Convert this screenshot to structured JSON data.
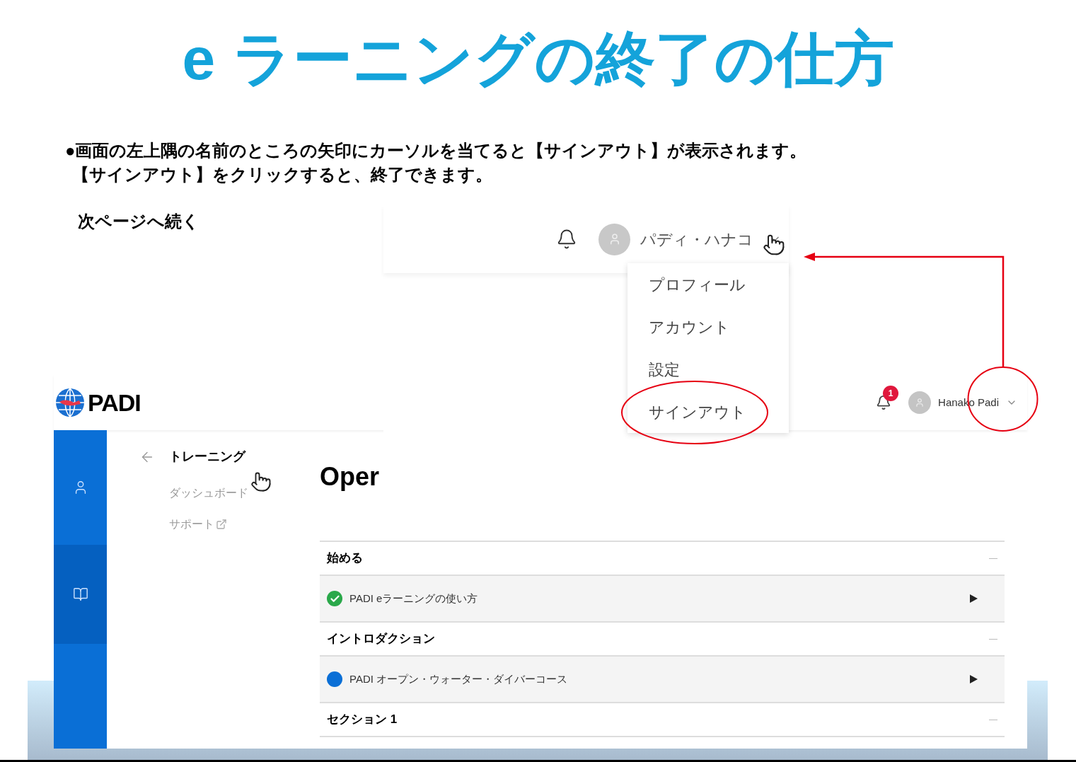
{
  "title": "e ラーニングの終了の仕方",
  "instructions": [
    "●画面の左上隅の名前のところの矢印にカーソルを当てると【サインアウト】が表示されます。",
    "【サインアウト】をクリックすると、終了できます。"
  ],
  "note": "次ページへ続く",
  "popup": {
    "user_name": "パディ・ハナコ",
    "menu": [
      {
        "label": "プロフィール",
        "circled": false
      },
      {
        "label": "アカウント",
        "circled": false
      },
      {
        "label": "設定",
        "circled": false
      },
      {
        "label": "サインアウト",
        "circled": true
      }
    ]
  },
  "app": {
    "logo": "PADI",
    "notification_count": "1",
    "user_menu": {
      "name": "Hanako Padi",
      "circled": true
    },
    "sidebar": [
      {
        "kind": "user",
        "selected": false
      },
      {
        "kind": "book",
        "selected": true
      }
    ],
    "nav": {
      "title": "トレーニング",
      "items": [
        {
          "label": "ダッシュボード",
          "external": false
        },
        {
          "label": "サポート",
          "external": true
        }
      ]
    },
    "heading": "Oper",
    "sections": [
      {
        "title": "始める",
        "lessons": [
          {
            "title": "PADI eラーニングの使い方",
            "kind": "complete"
          }
        ]
      },
      {
        "title": "イントロダクション",
        "lessons": [
          {
            "title": "PADI オープン・ウォーター・ダイバーコース",
            "kind": "current"
          }
        ]
      },
      {
        "title": "セクション 1"
      }
    ]
  }
}
